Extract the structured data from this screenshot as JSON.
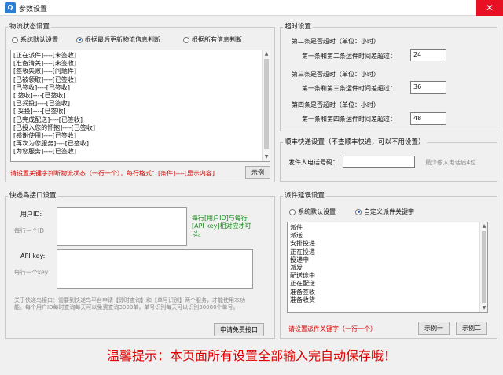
{
  "window": {
    "title": "参数设置",
    "close_glyph": "✕"
  },
  "logistics_status": {
    "title": "物流状态设置",
    "options": [
      "系统默认设置",
      "根据最后更新物流信息判断",
      "根据所有信息判断"
    ],
    "selected_index": 1,
    "lines": [
      "[正在派件]----[未签收]",
      "[准备清关]----[未签收]",
      "[签收失败]----[问题件]",
      "[已被领取]----[已签收]",
      "[已签收]----[已签收]",
      "[ 签收]----[已签收]",
      "[已妥投]----[已签收]",
      "[ 妥投]----[已签收]",
      "[已完成配送]----[已签收]",
      "[已投入您的怀抱]----[已签收]",
      "[感谢使用]----[已签收]",
      "[再次为您服务]----[已签收]",
      "[为您服务]----[已签收]"
    ],
    "note": "请设置关键字判断物流状态（一行一个），每行格式：[条件]----[显示内容]",
    "example_button": "示例"
  },
  "timeout": {
    "title": "超时设置",
    "blocks": [
      {
        "heading": "第二条是否超时（单位：小时）",
        "label": "第一条和第二条运件时间差超过：",
        "value": "24"
      },
      {
        "heading": "第三条是否超时（单位：小时）",
        "label": "第一条和第三条运件时间差超过：",
        "value": "36"
      },
      {
        "heading": "第四条是否超时（单位：小时）",
        "label": "第一条和第四条运件时间差超过：",
        "value": "48"
      }
    ]
  },
  "sf": {
    "title": "顺丰快递设置（不查顺丰快递，可以不用设置）",
    "phone_label": "发件人电话号码：",
    "phone_value": "",
    "hint": "最少输入电话后4位"
  },
  "kdn": {
    "title": "快递鸟接口设置",
    "user_id_label": "用户ID:",
    "user_id_placeholder": "每行一个ID",
    "api_key_label": "API key:",
    "api_key_placeholder": "每行一个key",
    "pair_hint": "每行[用户ID]与每行[API key]相对应才可以。",
    "about": "关于快递鸟接口：需要到快递鸟平台申请【即时查询】和【单号识别】两个服务，才能使用本功能。每个用户ID每时查询每天可以免费查询3000单，单号识别每天可以识别30000个单号。",
    "apply_button": "申请免费接口"
  },
  "dispatch": {
    "title": "派件延误设置",
    "options": [
      "系统默认设置",
      "自定义派件关键字"
    ],
    "selected_index": 1,
    "lines": [
      "派件",
      "派送",
      "安排投递",
      "正在投递",
      "投递中",
      "派发",
      "配送途中",
      "正在配送",
      "准备签收",
      "准备收货"
    ],
    "note": "请设置派件关键字（一行一个）",
    "example1_button": "示例一",
    "example2_button": "示例二"
  },
  "footer": {
    "tip": "温馨提示：本页面所有设置全部输入完自动保存哦！"
  },
  "colors": {
    "accent": "#1a5fb4",
    "warning": "#d40000",
    "hint_green": "#1a8a1a",
    "close": "#e81123"
  }
}
